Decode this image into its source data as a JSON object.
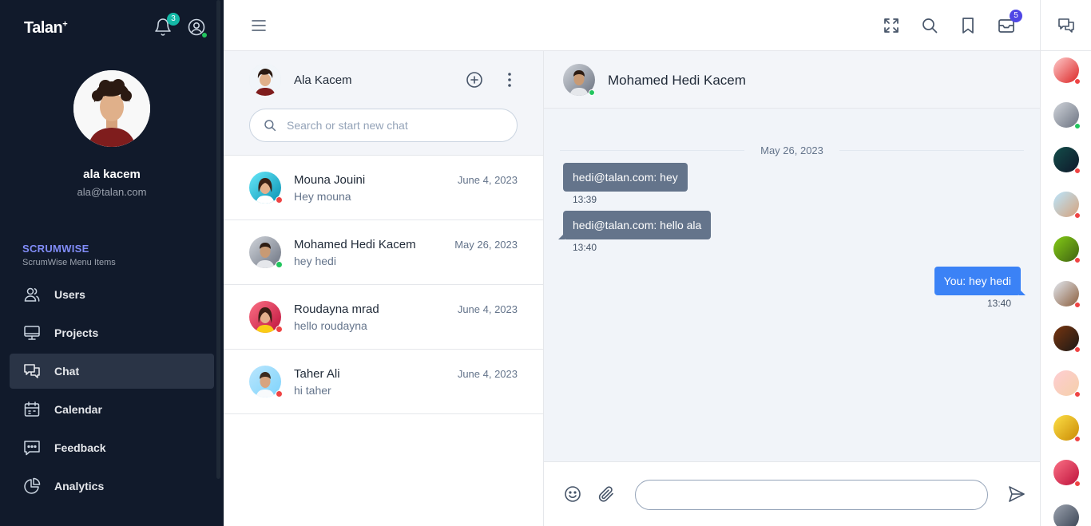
{
  "sidebar": {
    "brand": "Talan",
    "brand_mark": "+",
    "notification_count": "3",
    "user": {
      "name": "ala kacem",
      "email": "ala@talan.com"
    },
    "section_title": "SCRUMWISE",
    "section_subtitle": "ScrumWise Menu Items",
    "menu": [
      {
        "label": "Users",
        "icon": "users-icon"
      },
      {
        "label": "Projects",
        "icon": "monitor-icon"
      },
      {
        "label": "Chat",
        "icon": "chat-icon",
        "active": true
      },
      {
        "label": "Calendar",
        "icon": "calendar-icon"
      },
      {
        "label": "Feedback",
        "icon": "feedback-icon"
      },
      {
        "label": "Analytics",
        "icon": "pie-chart-icon"
      }
    ]
  },
  "topbar": {
    "icons": [
      "menu-icon",
      "fullscreen-icon",
      "search-icon",
      "bookmark-icon",
      "mail-icon"
    ],
    "mail_count": "5"
  },
  "chat_list": {
    "me_name": "Ala Kacem",
    "search_placeholder": "Search or start new chat",
    "conversations": [
      {
        "name": "Mouna Jouini",
        "date": "June 4, 2023",
        "last_message": "Hey mouna",
        "status": "offline"
      },
      {
        "name": "Mohamed Hedi Kacem",
        "date": "May 26, 2023",
        "last_message": "hey hedi",
        "status": "online"
      },
      {
        "name": "Roudayna mrad",
        "date": "June 4, 2023",
        "last_message": "hello roudayna",
        "status": "offline"
      },
      {
        "name": "Taher Ali",
        "date": "June 4, 2023",
        "last_message": "hi taher",
        "status": "offline"
      }
    ]
  },
  "conversation": {
    "contact_name": "Mohamed Hedi Kacem",
    "date_separator": "May 26, 2023",
    "messages": [
      {
        "direction": "in",
        "text": "hedi@talan.com: hey",
        "time": "13:39"
      },
      {
        "direction": "in",
        "text": "hedi@talan.com: hello ala",
        "time": "13:40"
      },
      {
        "direction": "out",
        "text": "You: hey hedi",
        "time": "13:40"
      }
    ],
    "input_value": ""
  },
  "colors": {
    "sidebar_bg": "#111a2b",
    "accent": "#818cf8",
    "incoming_bubble": "#64748b",
    "outgoing_bubble": "#3b82f6",
    "online": "#22c55e",
    "offline": "#ef4444"
  }
}
